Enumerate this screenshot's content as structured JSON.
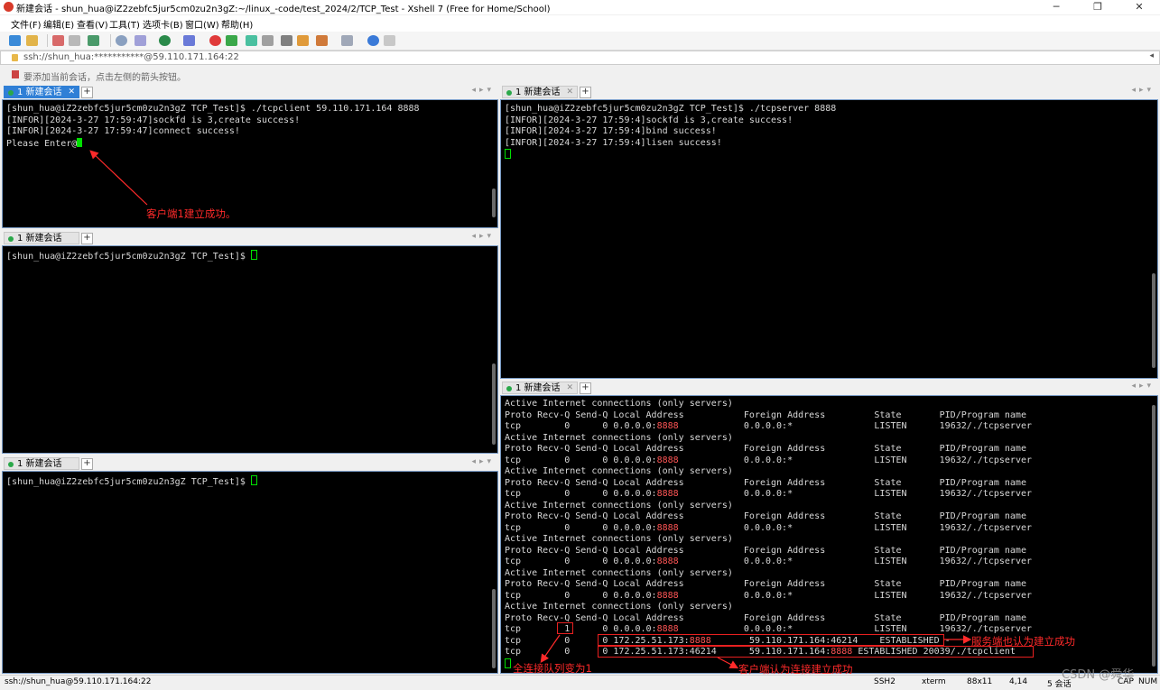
{
  "window": {
    "title": "新建会话 - shun_hua@iZ2zebfc5jur5cm0zu2n3gZ:~/linux_-code/test_2024/2/TCP_Test - Xshell 7 (Free for Home/School)",
    "minimize": "─",
    "maximize": "❐",
    "close": "✕"
  },
  "menu": [
    "文件(F)",
    "编辑(E)",
    "查看(V)",
    "工具(T)",
    "选项卡(B)",
    "窗口(W)",
    "帮助(H)"
  ],
  "address": {
    "value": "ssh://shun_hua:***********@59.110.171.164:22",
    "dropdown": "◂"
  },
  "hint": "要添加当前会话，点击左侧的箭头按钮。",
  "tab_label": "1 新建会话",
  "tab_close": "✕",
  "tab_add": "+",
  "tab_nav": "◂▸▾",
  "panes": {
    "client": {
      "lines": [
        "[shun_hua@iZ2zebfc5jur5cm0zu2n3gZ TCP_Test]$ ./tcpclient 59.110.171.164 8888",
        "[INFOR][2024-3-27 17:59:47]sockfd is 3,create success!",
        "[INFOR][2024-3-27 17:59:47]connect success!"
      ],
      "prompt": "Please Enter@"
    },
    "server": {
      "lines": [
        "[shun_hua@iZ2zebfc5jur5cm0zu2n3gZ TCP_Test]$ ./tcpserver 8888",
        "[INFOR][2024-3-27 17:59:4]sockfd is 3,create success!",
        "[INFOR][2024-3-27 17:59:4]bind success!",
        "[INFOR][2024-3-27 17:59:4]lisen success!"
      ]
    },
    "idle": {
      "prompt": "[shun_hua@iZ2zebfc5jur5cm0zu2n3gZ TCP_Test]$ "
    },
    "netstat": {
      "header1": "Active Internet connections (only servers)",
      "header2": "Proto Recv-Q Send-Q Local Address           Foreign Address         State       PID/Program name",
      "listen_pre": "tcp        0      0 0.0.0.0:",
      "listen_port": "8888",
      "listen_post": "            0.0.0.0:*               LISTEN      19632/./tcpserver",
      "repeat": 6,
      "last_listen_pre": "tcp        1      0 0.0.0.0:",
      "est1_pre": "tcp        0      0 172.25.51.173:",
      "est1_port": "8888",
      "est1_post": "       59.110.171.164:46214    ESTABLISHED -",
      "est2_pre": "tcp        0      0 172.25.51.173:46214      59.110.171.164:",
      "est2_port": "8888",
      "est2_post": " ESTABLISHED 20039/./tcpclient"
    }
  },
  "annotations": {
    "client_ok": "客户端1建立成功。",
    "server_ok": "服务端也认为建立成功",
    "queue": "全连接队列变为1",
    "client_conn": "客户端认为连接建立成功"
  },
  "status": {
    "left": "ssh://shun_hua@59.110.171.164:22",
    "protocol": "SSH2",
    "term": "xterm",
    "size": "88x11",
    "pos": "4,14",
    "sessions": "5 会话",
    "caps": "CAP",
    "num": "NUM"
  },
  "watermark": "CSDN @舜华"
}
